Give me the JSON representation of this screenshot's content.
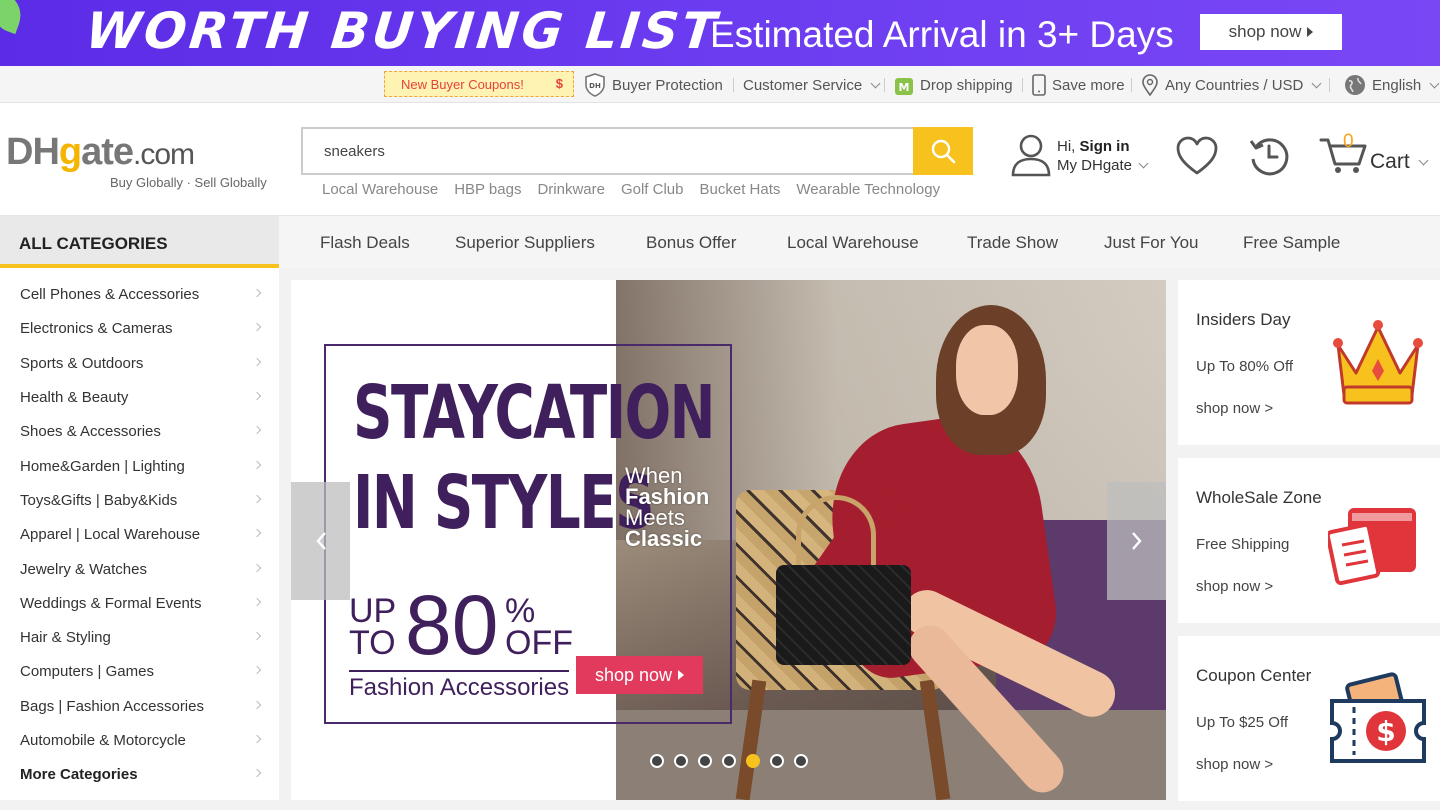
{
  "banner": {
    "headline": "WORTH BUYING LIST",
    "subtitle": "Estimated Arrival in 3+ Days",
    "cta": "shop now"
  },
  "util": {
    "coupon": "New Buyer Coupons!",
    "coupon_symbol": "$",
    "buyer_protection": "Buyer Protection",
    "customer_service": "Customer Service",
    "drop_shipping": "Drop shipping",
    "save_more": "Save more",
    "region": "Any Countries / USD",
    "language": "English"
  },
  "header": {
    "logo_dh": "DH",
    "logo_g": "g",
    "logo_rest": "ate",
    "logo_com": ".com",
    "tagline": "Buy Globally · Sell Globally",
    "search_value": "sneakers",
    "hot_links": [
      "Local Warehouse",
      "HBP bags",
      "Drinkware",
      "Golf Club",
      "Bucket Hats",
      "Wearable Technology"
    ],
    "greeting": "Hi,",
    "sign_in": "Sign in",
    "my_account": "My DHgate",
    "cart_count": "0",
    "cart_label": "Cart"
  },
  "nav": {
    "all_categories": "ALL CATEGORIES",
    "items": [
      "Flash Deals",
      "Superior Suppliers",
      "Bonus Offer",
      "Local Warehouse",
      "Trade Show",
      "Just For You",
      "Free Sample"
    ]
  },
  "categories": [
    "Cell Phones & Accessories",
    "Electronics & Cameras",
    "Sports & Outdoors",
    "Health & Beauty",
    "Shoes & Accessories",
    "Home&Garden  | Lighting",
    "Toys&Gifts  | Baby&Kids",
    "Apparel  | Local Warehouse",
    "Jewelry & Watches",
    "Weddings & Formal Events",
    "Hair & Styling",
    "Computers  | Games",
    "Bags  | Fashion Accessories",
    "Automobile & Motorcycle",
    "More Categories"
  ],
  "carousel": {
    "title_line1": "STAYCATION",
    "title_line2": "IN STYLES",
    "sub1": "When",
    "sub2": "Fashion",
    "sub3": "Meets",
    "sub4": "Classic",
    "up": "UP",
    "to": "TO",
    "percent_value": "80",
    "percent_sign": "%",
    "off": "OFF",
    "category": "Fashion Accessories",
    "cta": "shop now",
    "slide_count": 7,
    "active_slide": 5
  },
  "side_cards": [
    {
      "title": "Insiders Day",
      "desc": "Up To 80% Off",
      "link": "shop now >",
      "icon": "crown-icon"
    },
    {
      "title": "WholeSale Zone",
      "desc": "Free Shipping",
      "link": "shop now >",
      "icon": "box-checklist-icon"
    },
    {
      "title": "Coupon Center",
      "desc": "Up To $25 Off",
      "link": "shop now >",
      "icon": "coupon-icon"
    }
  ],
  "colors": {
    "banner_purple": "#5b2be6",
    "accent_yellow": "#f7c21d",
    "cart_orange": "#f7a51d",
    "promo_pink": "#e23a5c",
    "promo_purple": "#3f1f5c"
  }
}
